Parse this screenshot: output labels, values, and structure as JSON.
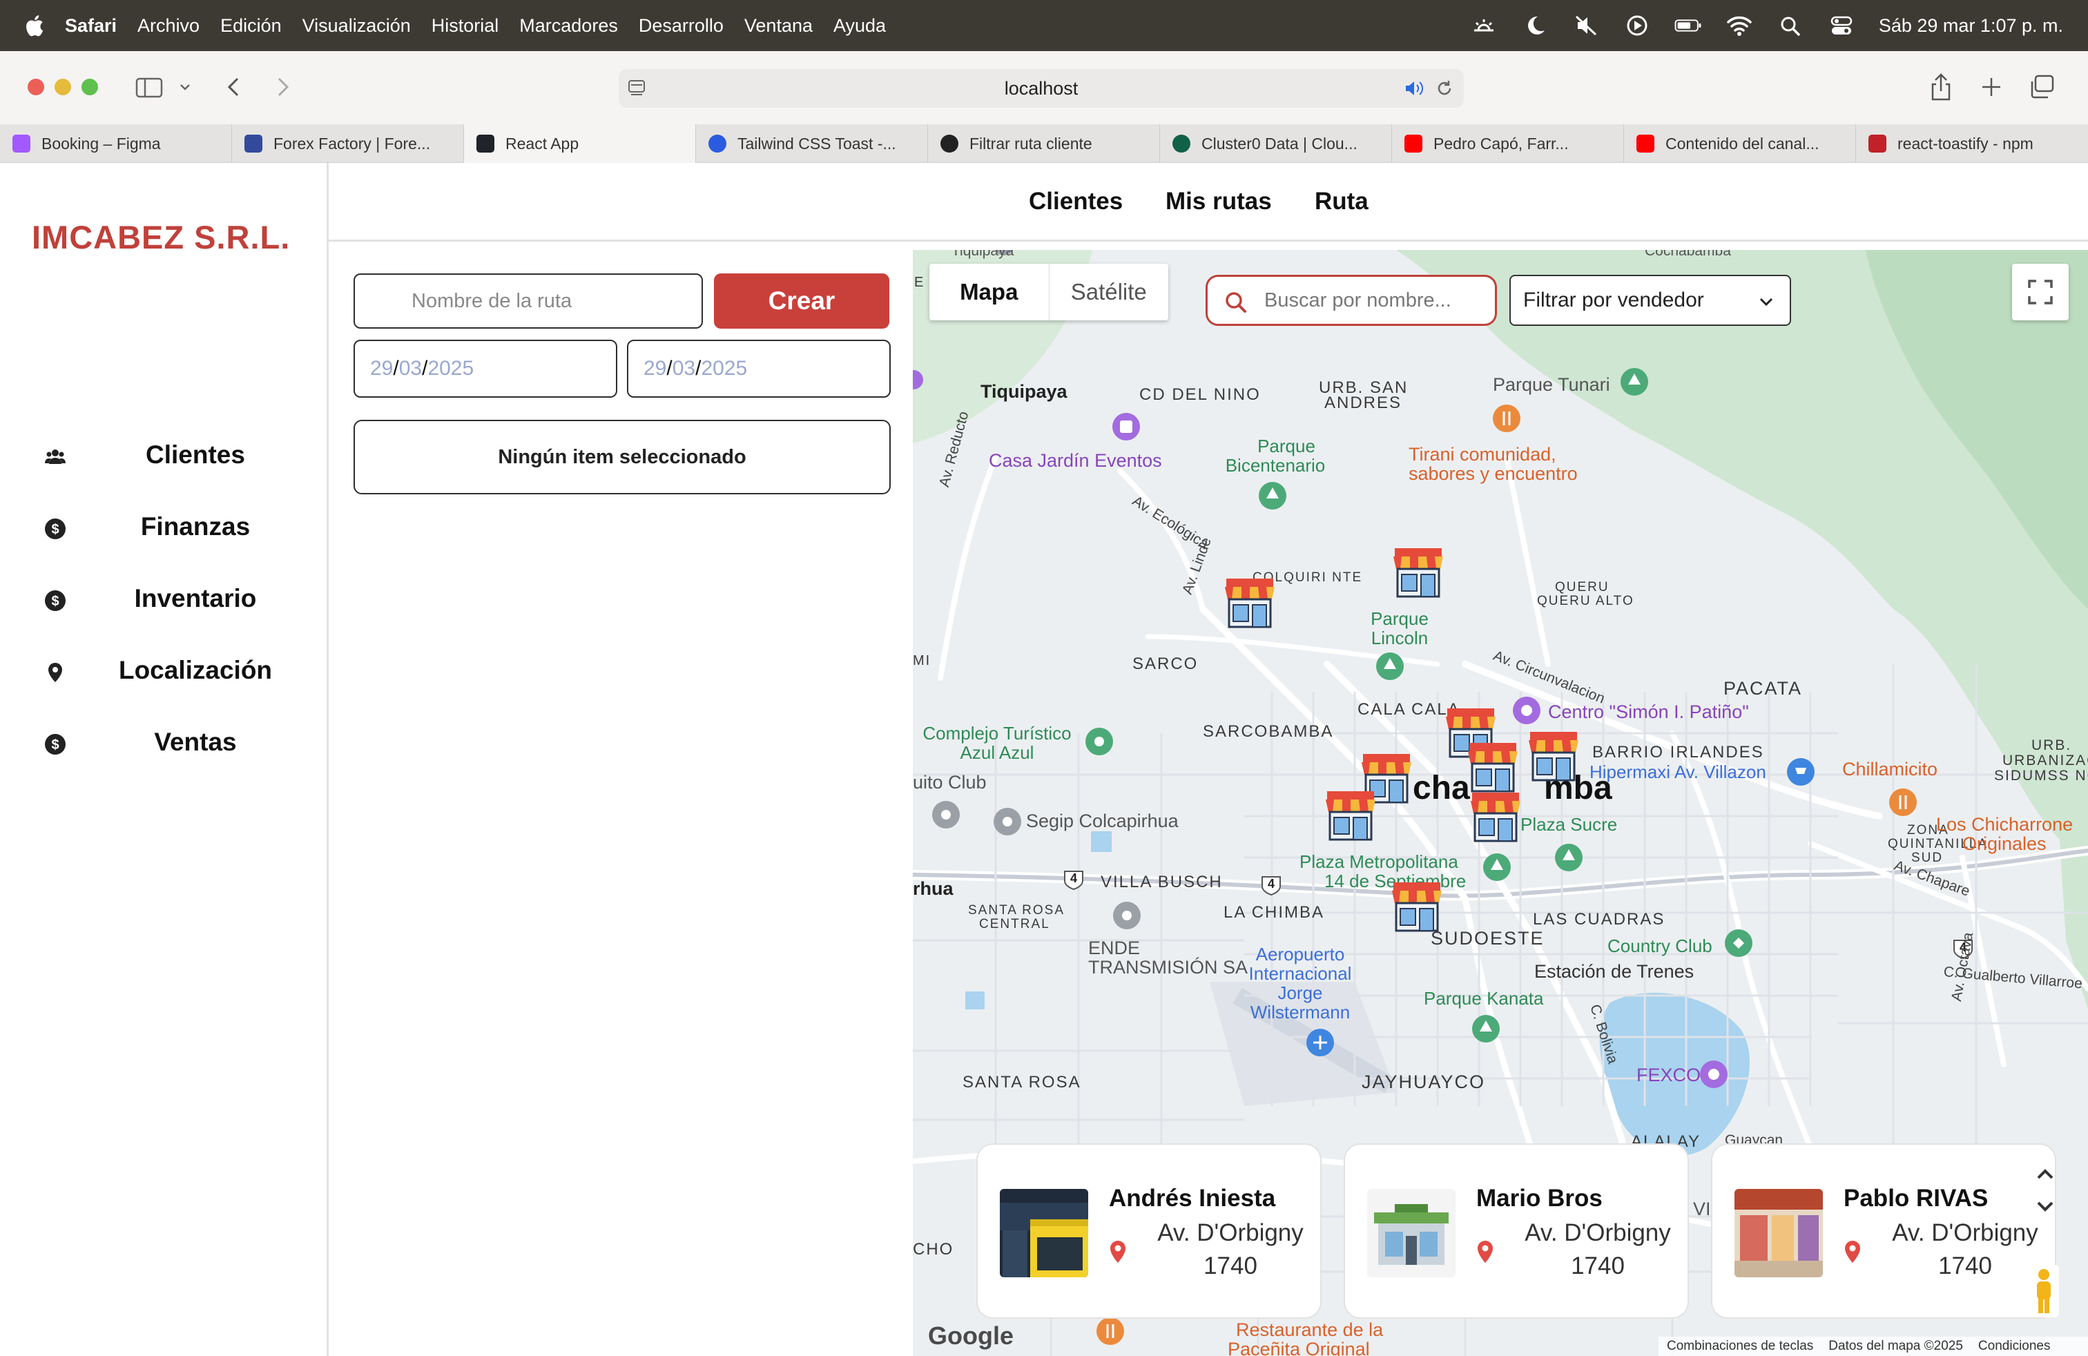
{
  "menubar": {
    "app_name": "Safari",
    "items": [
      "Archivo",
      "Edición",
      "Visualización",
      "Historial",
      "Marcadores",
      "Desarrollo",
      "Ventana",
      "Ayuda"
    ],
    "datetime": "Sáb 29 mar  1:07 p. m."
  },
  "browser": {
    "address": "localhost",
    "tabs": [
      {
        "label": "Booking – Figma",
        "color": "#a259ff"
      },
      {
        "label": "Forex Factory | Fore...",
        "color": "#334a9c"
      },
      {
        "label": "React App",
        "color": "#20232a"
      },
      {
        "label": "Tailwind CSS Toast -...",
        "color": "#2b5ce0"
      },
      {
        "label": "Filtrar ruta cliente",
        "color": "#222222"
      },
      {
        "label": "Cluster0 Data | Clou...",
        "color": "#116149"
      },
      {
        "label": "Pedro Capó, Farr...",
        "color": "#ff0000"
      },
      {
        "label": "Contenido del canal...",
        "color": "#ff0000"
      },
      {
        "label": "react-toastify - npm",
        "color": "#c12127"
      }
    ],
    "active_tab": 2
  },
  "brand": {
    "name": "IMCABEZ S.R.L.",
    "color": "#c0413a"
  },
  "sidebar": {
    "items": [
      {
        "label": "Clientes",
        "icon": "users-icon"
      },
      {
        "label": "Finanzas",
        "icon": "dollar-icon"
      },
      {
        "label": "Inventario",
        "icon": "dollar-icon"
      },
      {
        "label": "Localización",
        "icon": "location-pin-icon"
      },
      {
        "label": "Ventas",
        "icon": "dollar-icon"
      }
    ]
  },
  "topnav": {
    "links": [
      "Clientes",
      "Mis rutas",
      "Ruta"
    ]
  },
  "route_form": {
    "name_placeholder": "Nombre de la ruta",
    "create_label": "Crear",
    "start_date": {
      "day": "29",
      "month": "03",
      "year": "2025"
    },
    "end_date": {
      "day": "29",
      "month": "03",
      "year": "2025"
    },
    "selection_text": "Ningún item seleccionado"
  },
  "map": {
    "type_options": [
      "Mapa",
      "Satélite"
    ],
    "selected_type": "Mapa",
    "search_placeholder": "Buscar por nombre...",
    "vendor_filter": "Filtrar por vendedor",
    "labels": {
      "tiquipaya": "Tiquipaya",
      "cd_del_nino": "CD DEL NINO",
      "urb_san_andres_1": "URB. SAN",
      "urb_san_andres_2": "ANDRES",
      "parque_tunari": "Parque Tunari",
      "casa_jardin": "Casa Jardín Eventos",
      "parque_bicentenario_1": "Parque",
      "parque_bicentenario_2": "Bicentenario",
      "tirani_1": "Tirani comunidad,",
      "tirani_2": "sabores y encuentro",
      "av_reducto": "Av. Reducto",
      "av_ecologica": "Av. Ecológica",
      "av_linde": "Av. Linde",
      "colquiri": "COLQUIRI NTE",
      "queru_1": "QUERU",
      "queru_2": "QUERU ALTO",
      "parque_lincoln_1": "Parque",
      "parque_lincoln_2": "Lincoln",
      "sarco": "SARCO",
      "av_circunvalacion": "Av. Circunvalacion",
      "pacata": "PACATA",
      "cala_cala": "CALA CALA",
      "centro_simon": "Centro \"Simón I. Patiño\"",
      "complejo_1": "Complejo Turístico",
      "complejo_2": "Azul Azul",
      "sarcobamba": "SARCOBAMBA",
      "barrio_irlandes": "BARRIO IRLANDES",
      "hipermaxi": "Hipermaxi Av. Villazon",
      "chillamicito": "Chillamicito",
      "urb_1": "URB.",
      "urb_2": "URBANIZACIÓ",
      "urb_3": "SIDUMSS NORT",
      "cochabamba_left": "cha",
      "cochabamba_right": "mba",
      "uito_club": "uito Club",
      "segip": "Segip Colcapirhua",
      "plaza_sucre": "Plaza Sucre",
      "zona_1": "ZONA",
      "zona_2": "QUINTANILLA",
      "zona_3": "SUD",
      "chicharrones_1": "Los Chicharrone",
      "chicharrones_2": "Originales",
      "av_chapare": "Av. Chapare",
      "rhua": "rhua",
      "villa_busch": "VILLA BUSCH",
      "plaza_metro_1": "Plaza Metropolitana",
      "plaza_metro_2": "14 de Septiembre",
      "santa_rosa_central_1": "SANTA ROSA",
      "santa_rosa_central_2": "CENTRAL",
      "la_chimba": "LA CHIMBA",
      "las_cuadras": "LAS CUADRAS",
      "country_club": "Country Club",
      "av_octava": "Av. Octava",
      "c_gualberto": "C. Gualberto Villarroe",
      "ende_1": "ENDE",
      "ende_2": "TRANSMISIÓN SA",
      "aeropuerto_1": "Aeropuerto",
      "aeropuerto_2": "Internacional",
      "aeropuerto_3": "Jorge",
      "aeropuerto_4": "Wilstermann",
      "sudoeste": "SUDOESTE",
      "estacion": "Estación de Trenes",
      "parque_kanata": "Parque Kanata",
      "c_bolivia": "C. Bolivia",
      "santa_rosa": "SANTA ROSA",
      "jayhuayco": "JAYHUAYCO",
      "fexco": "FEXCO",
      "alalay": "ALALAY",
      "guaycan": "Guaycan",
      "cho": "CHO",
      "vi": "VI",
      "e": "E",
      "mi": "MI",
      "restaurante_1": "Restaurante de la",
      "restaurante_2": "Paceñita Original",
      "top_left_cut": "Tiquipaya",
      "top_right_cut": "Cochabamba"
    },
    "highway_shields": [
      "4",
      "4",
      "4"
    ],
    "attribution": {
      "google": "Google",
      "shortcuts": "Combinaciones de teclas",
      "data": "Datos del mapa ©2025",
      "terms": "Condiciones"
    },
    "clients": [
      {
        "name": "Andrés Iniesta",
        "address_line1": "Av. D'Orbigny",
        "address_line2": "1740",
        "image": "storefront-yellow"
      },
      {
        "name": "Mario Bros",
        "address_line1": "Av. D'Orbigny",
        "address_line2": "1740",
        "image": "tienda-building"
      },
      {
        "name": "Pablo RIVAS",
        "address_line1": "Av. D'Orbigny",
        "address_line2": "1740",
        "image": "duty-free-store"
      }
    ]
  }
}
